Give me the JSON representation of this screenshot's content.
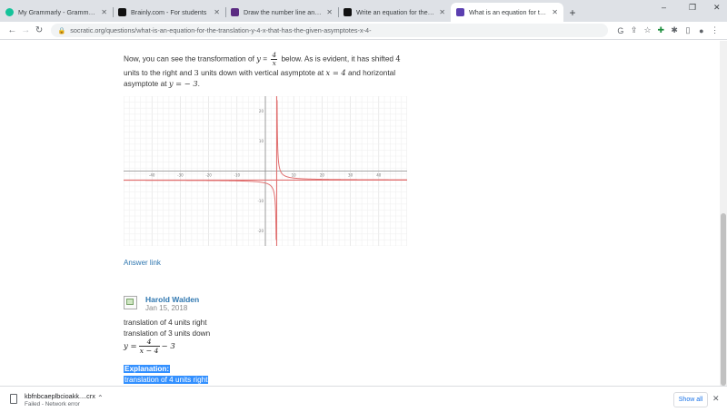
{
  "tabs": [
    {
      "title": "My Grammarly - Grammarly",
      "favicon_color": "#15c39a",
      "active": false
    },
    {
      "title": "Brainly.com - For students",
      "favicon_color": "#111111",
      "active": false
    },
    {
      "title": "Draw the number line and repres",
      "favicon_color": "#5b2b82",
      "active": false
    },
    {
      "title": "Write an equation for the translat",
      "favicon_color": "#111111",
      "active": false
    },
    {
      "title": "What is an equation for the trans",
      "favicon_color": "#5b3fb0",
      "active": true
    }
  ],
  "window_controls": {
    "minimize": "–",
    "restore": "❐",
    "close": "✕"
  },
  "address_bar": {
    "url": "socratic.org/questions/what-is-an-equation-for-the-translation-y-4-x-that-has-the-given-asymptotes-x-4-"
  },
  "article": {
    "intro_before": "Now, you can see the transformation of ",
    "intro_var": "y",
    "intro_eq": " = ",
    "intro_num": "4",
    "intro_den": "x",
    "intro_after": " below. As is evident, it has shifted ",
    "shift_right": "4",
    "line2_a": "units to the right and ",
    "shift_down": "3",
    "line2_b": " units down with vertical asymptote at ",
    "v_asym": "x = 4",
    "line2_c": " and horizontal",
    "line3_a": "asymptote at ",
    "h_asym": "y = − 3",
    "line3_b": ".",
    "answer_link": "Answer link"
  },
  "answer": {
    "author": "Harold Walden",
    "date": "Jan 15, 2018",
    "line1": "translation of 4 units right",
    "line2": "translation of 3 units down",
    "eq_lhs": "y = ",
    "eq_num": "4",
    "eq_den": "x − 4",
    "eq_rhs": " − 3",
    "explanation_label": "Explanation:",
    "explanation_first": "translation of 4 units right"
  },
  "chart_data": {
    "type": "line",
    "title": "",
    "xlabel": "",
    "ylabel": "",
    "xlim": [
      -50,
      50
    ],
    "ylim": [
      -25,
      25
    ],
    "grid": true,
    "x_ticks": [
      -40,
      -30,
      -20,
      -10,
      10,
      20,
      30,
      40
    ],
    "y_ticks": [
      20,
      10,
      -10,
      -20
    ],
    "asymptotes": {
      "vertical_x": 4,
      "horizontal_y": -3
    },
    "series": [
      {
        "function": "4/(x-4)-3",
        "color": "#e07070"
      }
    ],
    "asymptote_color": "#e07070"
  },
  "download": {
    "filename": "kbfnbcaeplbcioakk....crx",
    "status": "Failed - Network error",
    "show_all": "Show all"
  },
  "colors": {
    "link": "#2f77b0",
    "highlight": "#3390ff"
  }
}
